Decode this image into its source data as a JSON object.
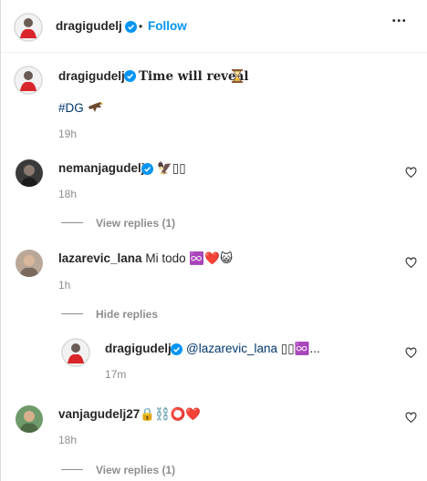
{
  "post": {
    "author": "dragigudelj",
    "separator": "•",
    "follow_label": "Follow",
    "more_label": "•••",
    "caption_author": "dragigudelj",
    "caption_text": "Time will reveal",
    "caption_emoji": "⏳",
    "hashtag": "#DG",
    "hashtag_emoji": "🦅",
    "caption_time": "19h"
  },
  "comments": [
    {
      "username": "nemanjagudelj",
      "verified": true,
      "text": "🦅▯▯",
      "time": "18h",
      "replies_label": "View replies (1)"
    },
    {
      "username": "lazarevic_lana",
      "verified": false,
      "text": "Mi todo ♾️❤️😺",
      "text_plain": "Mi todo",
      "time": "1h",
      "replies_label": "Hide replies",
      "reply": {
        "username": "dragigudelj",
        "verified": true,
        "mention": "@lazarevic_lana",
        "text": "▯▯♾️...",
        "time": "17m"
      }
    },
    {
      "username": "vanjagudelj27",
      "verified": false,
      "text": "🔒⛓️⭕❤️",
      "time": "18h",
      "replies_label": "View replies (1)"
    }
  ],
  "colors": {
    "link": "#0095f6",
    "secondary": "#8e8e8e",
    "primary": "#262626",
    "heart_red": "#ed1c24"
  }
}
